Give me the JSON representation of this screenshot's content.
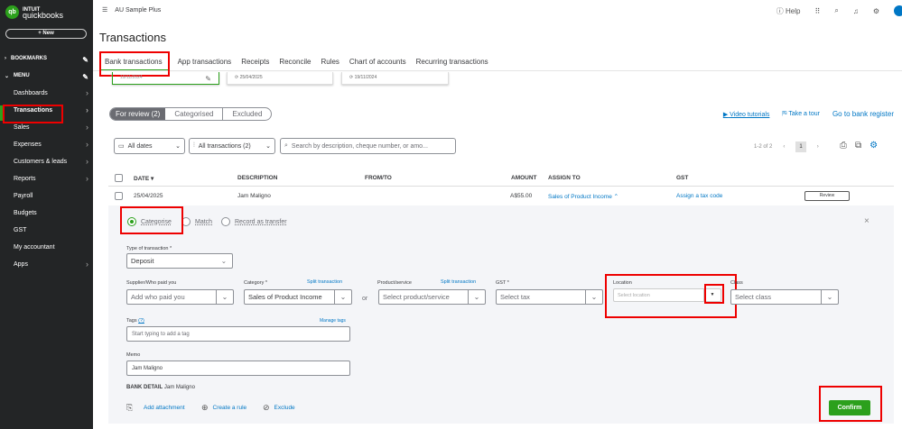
{
  "brand": {
    "intuit": "INTUIT",
    "name": "quickbooks",
    "logo_letters": "qb"
  },
  "sidebar": {
    "new_label": "+ New",
    "bookmarks": "BOOKMARKS",
    "menu": "MENU",
    "items": [
      {
        "label": "Dashboards",
        "chev": true
      },
      {
        "label": "Transactions",
        "chev": true
      },
      {
        "label": "Sales",
        "chev": true
      },
      {
        "label": "Expenses",
        "chev": true
      },
      {
        "label": "Customers & leads",
        "chev": true
      },
      {
        "label": "Reports",
        "chev": true
      },
      {
        "label": "Payroll"
      },
      {
        "label": "Budgets"
      },
      {
        "label": "GST"
      },
      {
        "label": "My accountant"
      },
      {
        "label": "Apps",
        "chev": true
      }
    ]
  },
  "topbar": {
    "company": "AU Sample Plus",
    "help": "Help"
  },
  "page_title": "Transactions",
  "tabs": [
    "Bank transactions",
    "App transactions",
    "Receipts",
    "Reconcile",
    "Rules",
    "Chart of accounts",
    "Recurring transactions"
  ],
  "account_cards": [
    {
      "date": "19/11/2024"
    },
    {
      "date": "25/04/2025"
    },
    {
      "date": "19/11/2024"
    }
  ],
  "review_tabs": [
    "For review (2)",
    "Categorised",
    "Excluded"
  ],
  "links": {
    "video": "Video tutorials",
    "tour": "Take a tour",
    "register": "Go to bank register"
  },
  "filters": {
    "dates": "All dates",
    "transactions": "All transactions (2)",
    "search_placeholder": "Search by description, cheque number, or amo..."
  },
  "pager": {
    "range": "1-2 of 2",
    "page": "1"
  },
  "table": {
    "headers": [
      "DATE ▾",
      "DESCRIPTION",
      "FROM/TO",
      "AMOUNT",
      "ASSIGN TO",
      "GST"
    ],
    "row": {
      "date": "25/04/2025",
      "description": "Jam Maligno",
      "amount": "A$55.00",
      "assign": "Sales of Product Income",
      "gst": "Assign a tax code",
      "action": "Review"
    }
  },
  "panel": {
    "radios": [
      "Categorise",
      "Match",
      "Record as transfer"
    ],
    "type_label": "Type of transaction *",
    "type_value": "Deposit",
    "payee_label": "Supplier/Who paid you",
    "payee_placeholder": "Add who paid you",
    "category_label": "Category *",
    "category_value": "Sales of Product Income",
    "split": "Split transaction",
    "or": "or",
    "product_label": "Product/service",
    "product_placeholder": "Select product/service",
    "gst_label": "GST *",
    "gst_placeholder": "Select tax",
    "location_label": "Location",
    "location_placeholder": "Select location",
    "class_label": "Class",
    "class_placeholder": "Select class",
    "tags_label": "Tags",
    "tags_help": "(?)",
    "manage_tags": "Manage tags",
    "tags_placeholder": "Start typing to add a tag",
    "memo_label": "Memo",
    "memo_value": "Jam Maligno",
    "bank_detail_label": "BANK DETAIL",
    "bank_detail_value": "Jam Maligno",
    "actions": [
      "Add attachment",
      "Create a rule",
      "Exclude"
    ],
    "confirm": "Confirm",
    "close": "×"
  },
  "colors": {
    "accent": "#2ca01c",
    "link": "#0077c5",
    "sidebar": "#232526",
    "highlight": "#e00000"
  }
}
